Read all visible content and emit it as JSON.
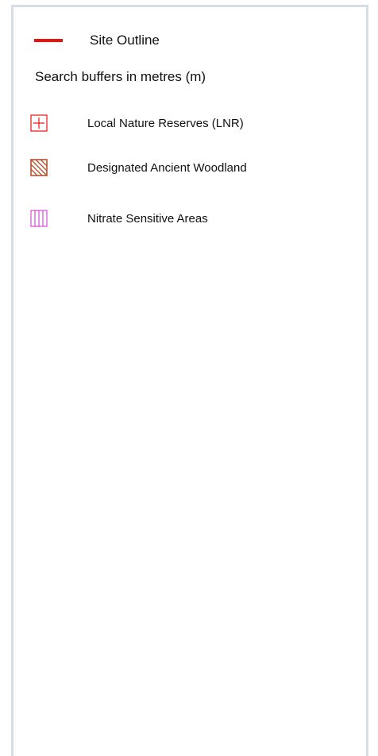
{
  "legend": {
    "site_outline": {
      "label": "Site Outline",
      "color": "#e8130d"
    },
    "buffers_heading": "Search buffers in metres (m)",
    "items": [
      {
        "label": "Local Nature Reserves (LNR)",
        "symbol": "cross-square-icon",
        "color": "#e8130d"
      },
      {
        "label": "Designated Ancient Woodland",
        "symbol": "diagonal-hatch-square-icon",
        "color": "#b5532f"
      },
      {
        "label": "Nitrate Sensitive Areas",
        "symbol": "vertical-hatch-square-icon",
        "color": "#d23bd6"
      }
    ]
  }
}
